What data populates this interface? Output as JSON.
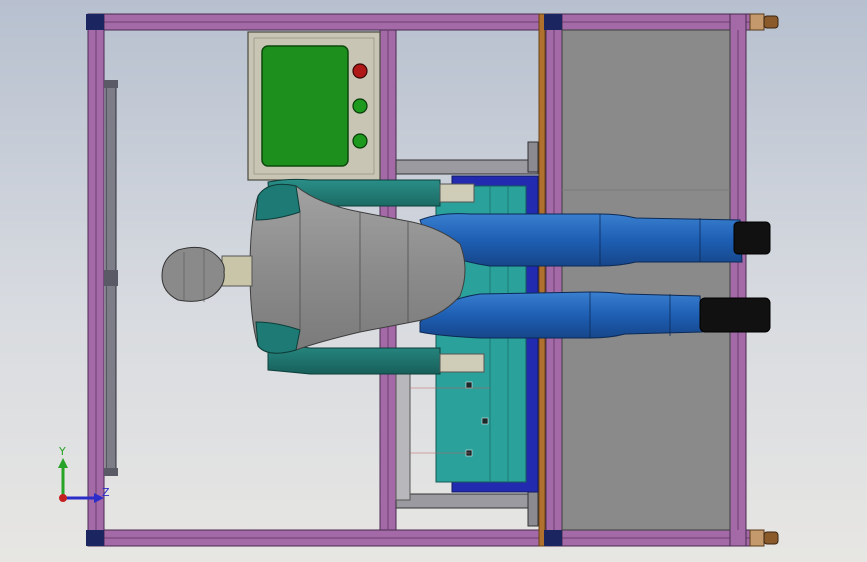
{
  "viewport": {
    "view": "top",
    "background_top": "#b7c0cf",
    "background_bottom": "#e7e6e3"
  },
  "triad": {
    "y_label": "Y",
    "z_label": "Z",
    "y_color": "#27a327",
    "z_color": "#2c2cc8",
    "x_color": "#c42020"
  },
  "colors": {
    "frame_purple": "#a46aa8",
    "frame_dark": "#6a3f70",
    "frame_joint": "#1b2560",
    "copper_bar": "#b0702e",
    "panel_gray": "#8a8a8a",
    "control_box": "#c8c5b5",
    "screen_green": "#1d8f1d",
    "stop_button": "#b01818",
    "go_button": "#1d9a1d",
    "seat_teal": "#2aa19a",
    "seat_blue": "#222bb0",
    "dummy_gray": "#8e8e8e",
    "dummy_teal": "#1d7a74",
    "leg_blue": "#1e5fb4",
    "shoe_black": "#111111",
    "caster_brown": "#8a5a2b"
  },
  "control_panel": {
    "buttons": [
      "stop",
      "start",
      "start"
    ]
  }
}
